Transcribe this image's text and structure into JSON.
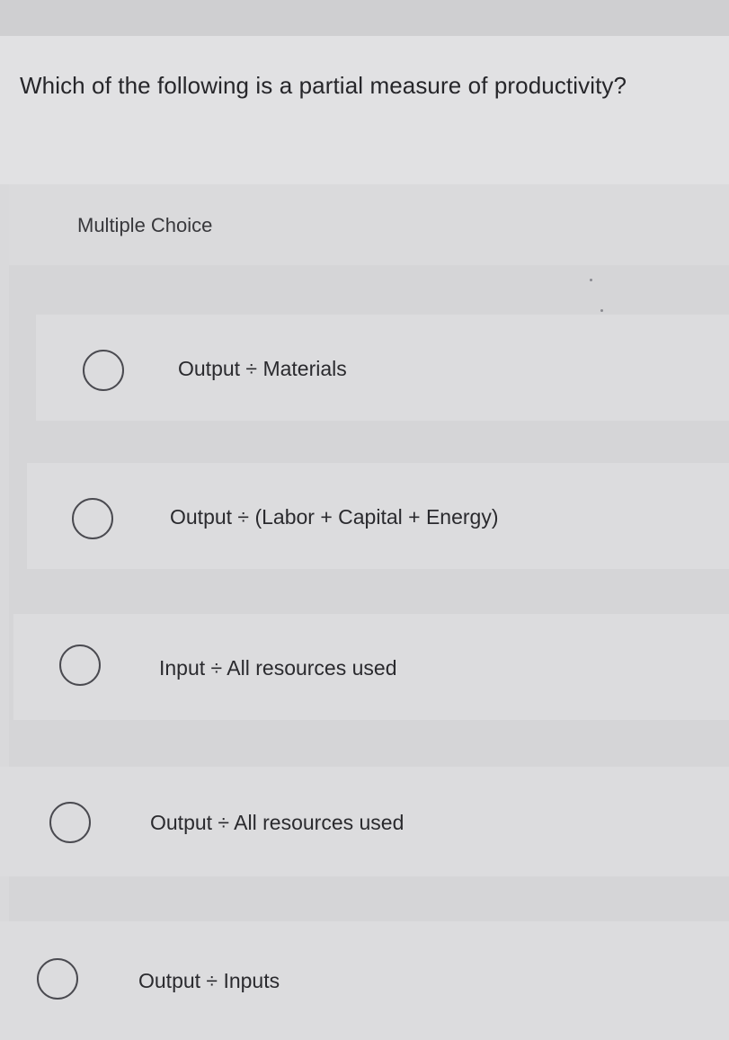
{
  "question": {
    "text": "Which of the following is a partial measure of productivity?"
  },
  "multiple_choice": {
    "label": "Multiple Choice",
    "options": [
      {
        "label": "Output ÷ Materials",
        "selected": false
      },
      {
        "label": "Output ÷ (Labor + Capital + Energy)",
        "selected": false
      },
      {
        "label": "Input ÷ All resources used",
        "selected": false
      },
      {
        "label": "Output ÷ All resources used",
        "selected": false
      },
      {
        "label": "Output ÷ Inputs",
        "selected": false
      }
    ]
  },
  "colors": {
    "background": "#d9d9db",
    "text": "#2a2a2e",
    "radio_border": "#4a4a50"
  }
}
